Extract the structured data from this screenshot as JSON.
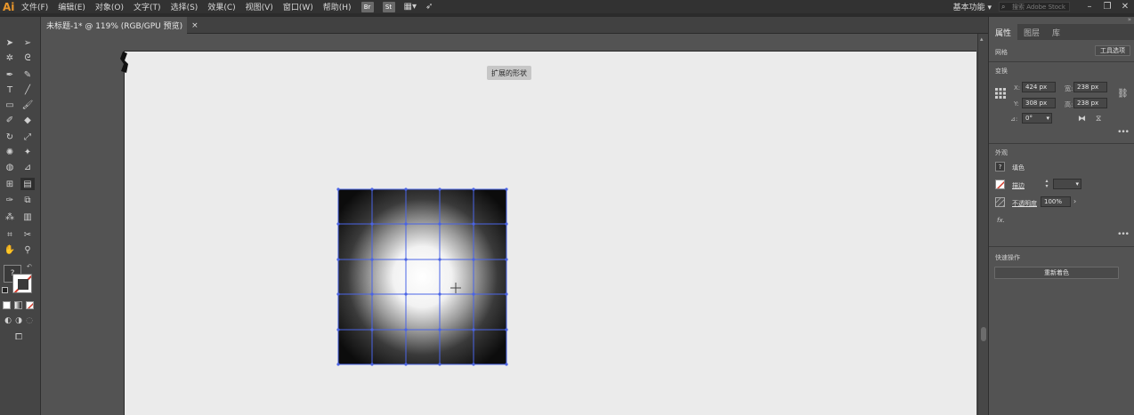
{
  "app": {
    "logo": "Ai"
  },
  "menu": {
    "items": [
      "文件(F)",
      "编辑(E)",
      "对象(O)",
      "文字(T)",
      "选择(S)",
      "效果(C)",
      "视图(V)",
      "窗口(W)",
      "帮助(H)"
    ],
    "bridge_btn": "Br",
    "stock_btn": "St",
    "workspace": "基本功能",
    "search_placeholder": "搜索 Adobe Stock"
  },
  "window_controls": {
    "minimize": "–",
    "restore": "❐",
    "close": "✕"
  },
  "document": {
    "tab_title": "未标题-1* @ 119% (RGB/GPU 预览)",
    "tab_close": "×",
    "tooltip": "扩展的形状"
  },
  "panel": {
    "tabs": [
      "属性",
      "图层",
      "库"
    ],
    "object_type": "网格",
    "tool_options_btn": "工具选项",
    "transform": {
      "title": "变换",
      "x_label": "X:",
      "x_value": "424 px",
      "y_label": "Y:",
      "y_value": "308 px",
      "w_label": "宽:",
      "w_value": "238 px",
      "h_label": "高:",
      "h_value": "238 px",
      "angle_label": "⊿:",
      "angle_value": "0°"
    },
    "appearance": {
      "title": "外观",
      "fill_label": "填色",
      "stroke_label": "描边",
      "opacity_label": "不透明度",
      "opacity_value": "100%",
      "fx_label": "fx."
    },
    "quick_actions": {
      "title": "快速操作",
      "recolor_btn": "重新着色"
    }
  },
  "colors": {
    "accent": "#e8962b",
    "mesh_line": "#4a64e6",
    "stroke_red": "#d23a2a"
  }
}
